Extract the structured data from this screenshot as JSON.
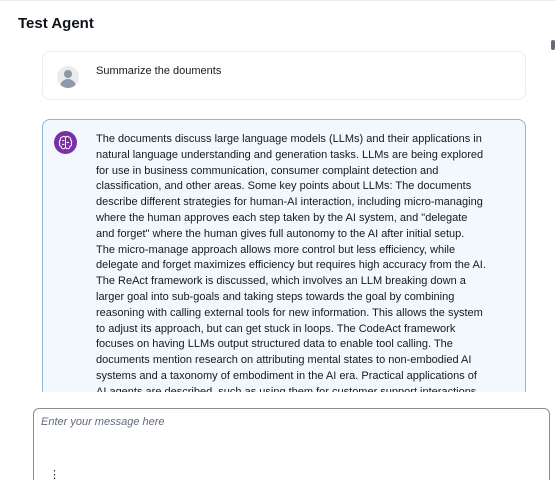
{
  "header": {
    "title": "Test Agent"
  },
  "conversation": {
    "user_message": "Summarize the douments",
    "assistant_message": "The documents discuss large language models (LLMs) and their applications in natural language understanding and generation tasks. LLMs are being explored for use in business communication, consumer complaint detection and classification, and other areas. Some key points about LLMs: The documents describe different strategies for human-AI interaction, including micro-managing where the human approves each step taken by the AI system, and \"delegate and forget\" where the human gives full autonomy to the AI after initial setup. The micro-manage approach allows more control but less efficiency, while delegate and forget maximizes efficiency but requires high accuracy from the AI. The ReAct framework is discussed, which involves an LLM breaking down a larger goal into sub-goals and taking steps towards the goal by combining reasoning with calling external tools for new information. This allows the system to adjust its approach, but can get stuck in loops. The CodeAct framework focuses on having LLMs output structured data to enable tool calling. The documents mention research on attributing mental states to non-embodied AI systems and a taxonomy of embodiment in the AI era. Practical applications of AI agents are described, such as using them for customer support interactions with personalized responses, for automating complex tasks, and for"
  },
  "composer": {
    "placeholder": "Enter your message here",
    "value": ""
  },
  "icons": {
    "user": "user-avatar-icon",
    "assistant": "brain-icon"
  },
  "colors": {
    "assistant_icon_bg": "#7b2fa8",
    "assistant_card_border": "#8ab7d1",
    "assistant_card_bg": "#f2f8fd"
  }
}
